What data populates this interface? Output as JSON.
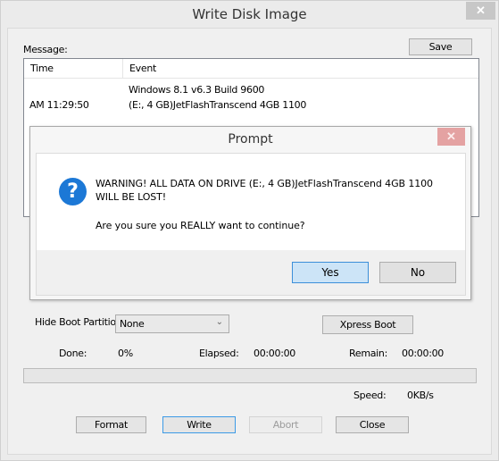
{
  "window": {
    "title": "Write Disk Image",
    "close_glyph": "✕"
  },
  "message_section": {
    "label": "Message:",
    "save_button": "Save",
    "columns": [
      "Time",
      "Event"
    ],
    "rows": [
      {
        "time": "",
        "event": "Windows 8.1 v6.3 Build 9600"
      },
      {
        "time": "AM 11:29:50",
        "event": "(E:, 4 GB)JetFlashTranscend 4GB   1100"
      }
    ]
  },
  "options": {
    "hide_boot_partition_label": "Hide Boot Partition:",
    "hide_boot_partition_value": "None",
    "xpress_boot_button": "Xpress Boot"
  },
  "status": {
    "done_label": "Done:",
    "done_value": "0%",
    "elapsed_label": "Elapsed:",
    "elapsed_value": "00:00:00",
    "remain_label": "Remain:",
    "remain_value": "00:00:00",
    "speed_label": "Speed:",
    "speed_value": "0KB/s",
    "progress_percent": 0
  },
  "actions": {
    "format": "Format",
    "write": "Write",
    "abort": "Abort",
    "close": "Close"
  },
  "prompt": {
    "title": "Prompt",
    "close_glyph": "✕",
    "icon": "question-icon",
    "icon_glyph": "?",
    "warning_line1": "WARNING! ALL DATA ON DRIVE (E:, 4 GB)JetFlashTranscend 4GB   1100",
    "warning_line2": "WILL BE LOST!",
    "question": "Are you sure you REALLY want to continue?",
    "yes_button": "Yes",
    "no_button": "No"
  },
  "colors": {
    "prompt_close_bg": "#e4a2a2",
    "question_icon": "#1c78d6",
    "default_button_bg": "#cce4f7",
    "focus_border": "#3c9ae6"
  }
}
